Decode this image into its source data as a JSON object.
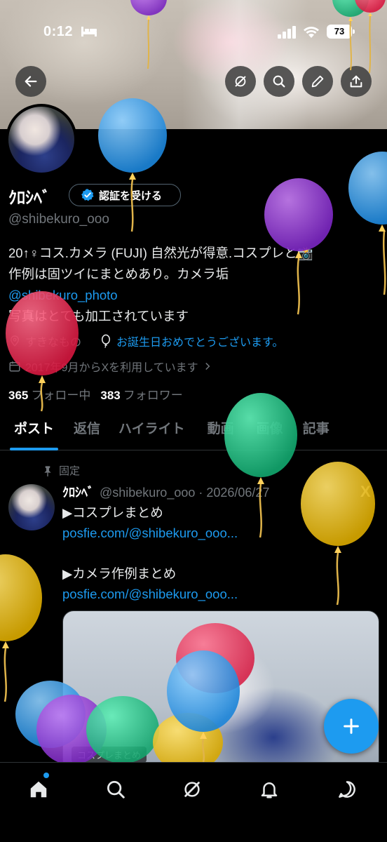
{
  "status_bar": {
    "time": "0:12",
    "battery": "73"
  },
  "profile": {
    "name": "ｸﾛｼﾍﾞ",
    "verify_label": "認証を受ける",
    "handle": "@shibekuro_ooo",
    "bio_lines": [
      "20↑♀コス.カメラ (FUJI) 自然光が得意.コスプレと📸",
      "作例は固ツイにまとめあり。カメラ垢",
      "@shibekuro_photo",
      "写真はとても加工されています"
    ],
    "location": "すきなもの",
    "birthday_text": "お誕生日おめでとうございます。",
    "joined": "2017年9月からXを利用しています",
    "following_count": "365",
    "following_label": "フォロー中",
    "followers_count": "383",
    "followers_label": "フォロワー"
  },
  "tabs": [
    {
      "label": "ポスト",
      "active": true
    },
    {
      "label": "返信",
      "active": false
    },
    {
      "label": "ハイライト",
      "active": false
    },
    {
      "label": "動画",
      "active": false
    },
    {
      "label": "画像",
      "active": false
    },
    {
      "label": "記事",
      "active": false
    }
  ],
  "pinned_post": {
    "pin_label": "固定",
    "author": "ｸﾛｼﾍﾞ",
    "meta": "@shibekuro_ooo · 2026/06/27",
    "x_mark": "X",
    "body_lines": [
      "▶コスプレまとめ",
      "posfie.com/@shibekuro_ooo...",
      "",
      "▶カメラ作例まとめ",
      "posfie.com/@shibekuro_ooo..."
    ],
    "media_caption": "コスプレまとめ"
  },
  "icons": {
    "back": "arrow-left-icon",
    "grok": "grok-icon",
    "search": "search-icon",
    "edit": "pencil-icon",
    "share": "share-icon",
    "home": "home-icon",
    "explore": "search-icon",
    "notifications": "bell-icon",
    "messages": "chat-icon"
  },
  "colors": {
    "accent": "#1d9bf0",
    "background": "#000000",
    "muted": "#71767b"
  }
}
